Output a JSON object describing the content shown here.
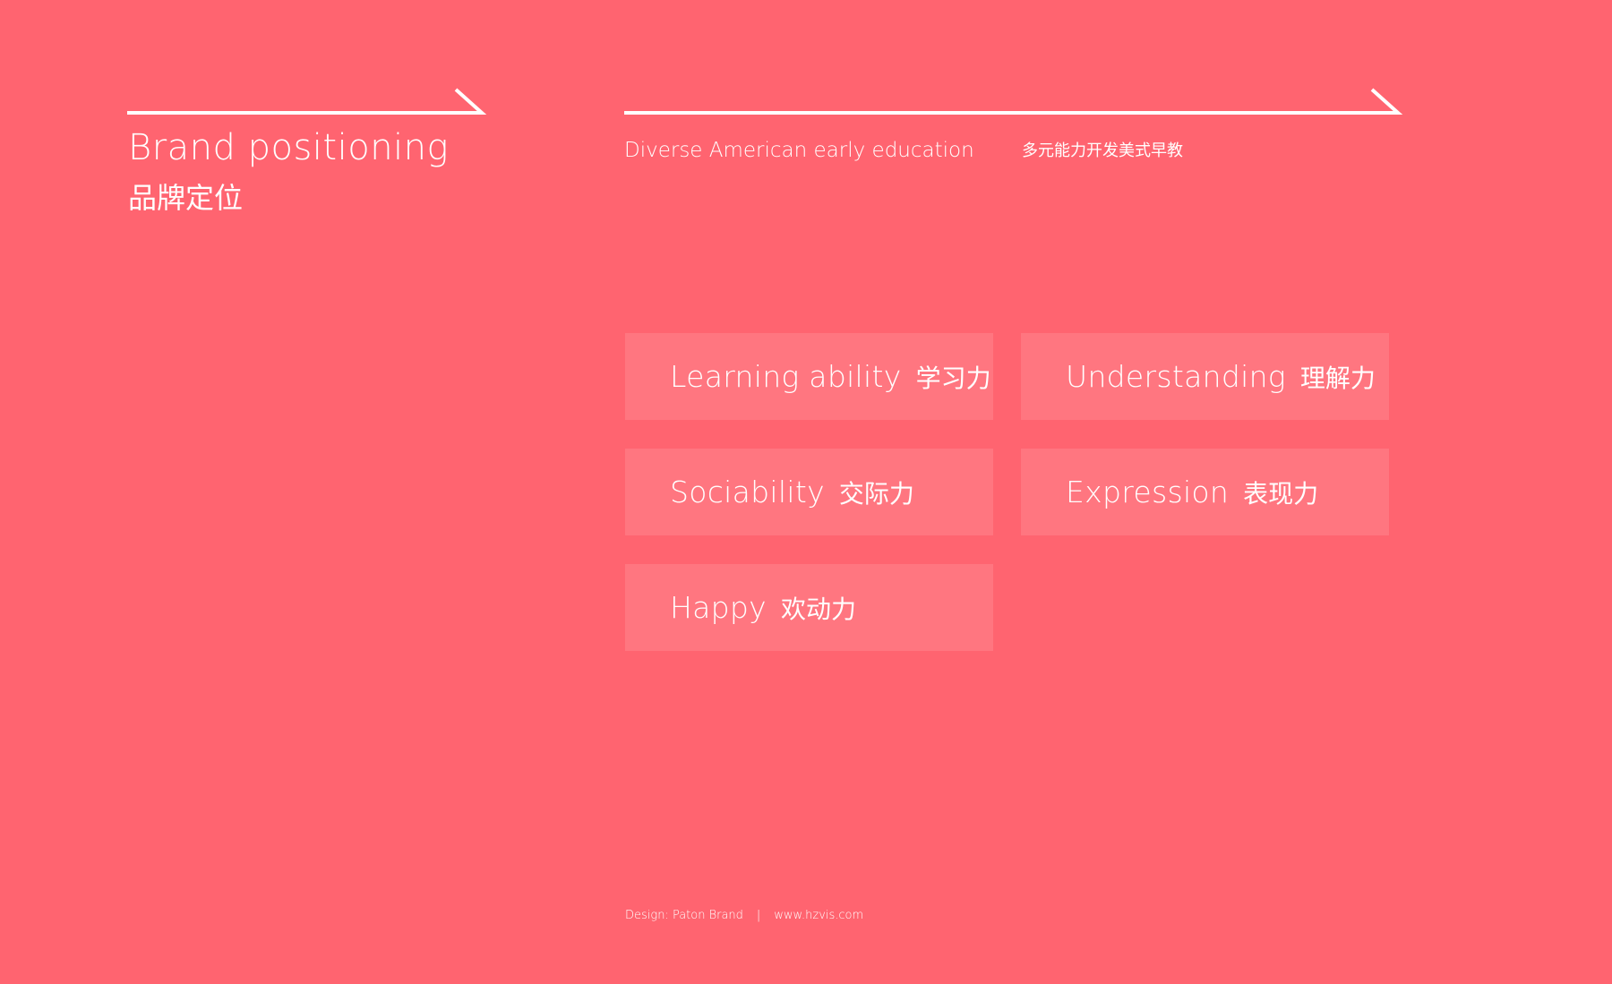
{
  "brand": {
    "title": "Brand positioning",
    "subtitle": "品牌定位"
  },
  "tagline": {
    "english": "Diverse American early education",
    "chinese": "多元能力开发美式早教"
  },
  "abilities": [
    {
      "en": "Learning ability",
      "cn": "学习力"
    },
    {
      "en": "Understanding",
      "cn": "理解力"
    },
    {
      "en": "Sociability",
      "cn": "交际力"
    },
    {
      "en": "Expression",
      "cn": "表现力"
    },
    {
      "en": "Happy",
      "cn": "欢动力"
    }
  ],
  "footer": {
    "design": "Design: Paton Brand",
    "separator": "|",
    "website": "www.hzvis.com"
  },
  "colors": {
    "background": "#ff6470",
    "card": "#ff7680",
    "text": "#ffffff"
  },
  "icons": {
    "arrow": "right-arrow-line-icon"
  }
}
